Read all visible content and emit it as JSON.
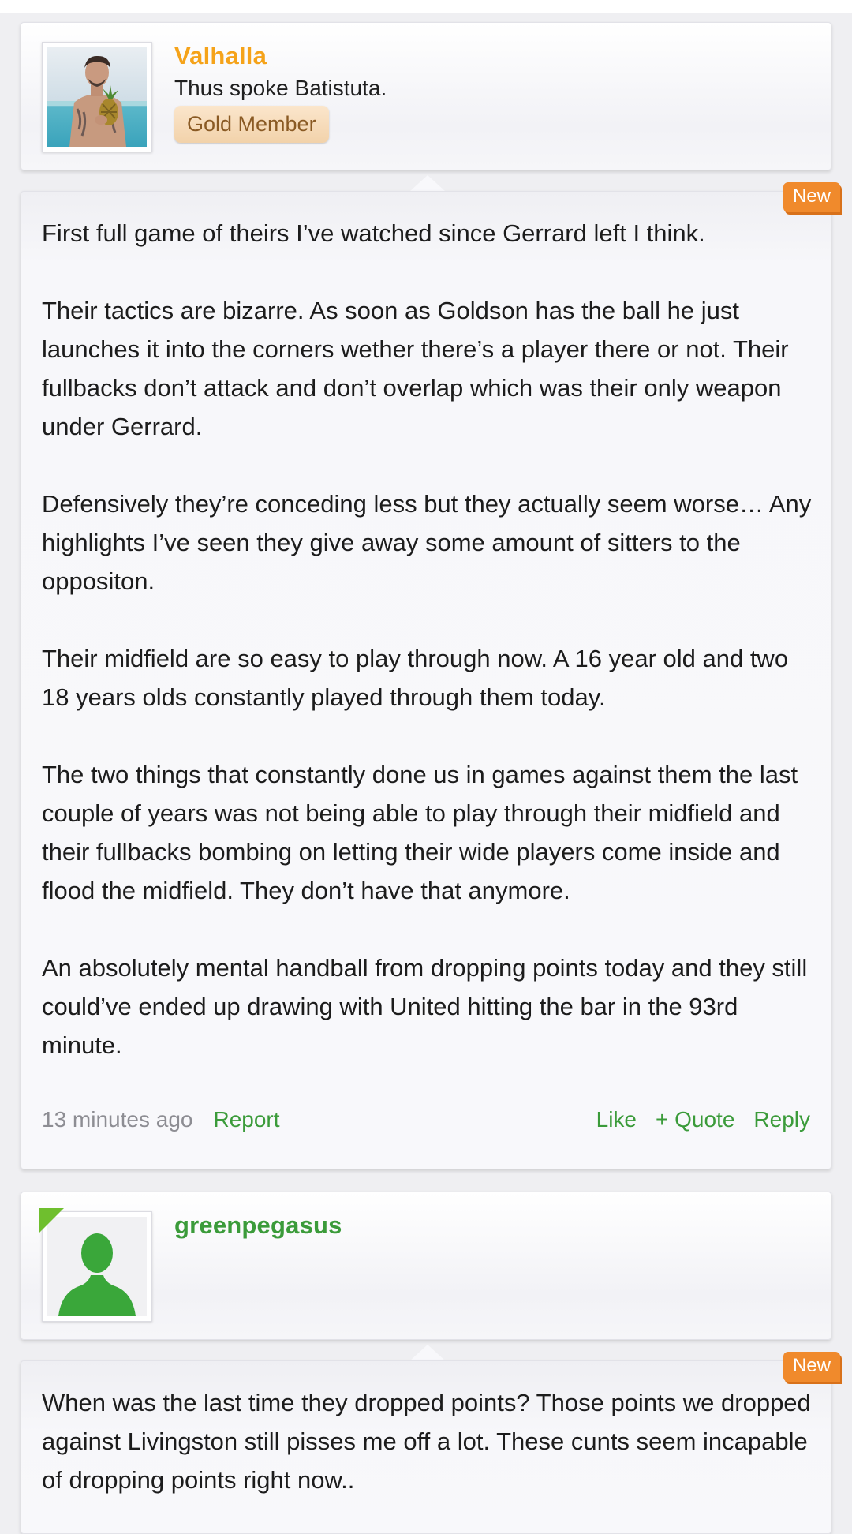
{
  "posts": [
    {
      "username": "Valhalla",
      "username_color": "#f5a31a",
      "user_title": "Thus spoke Batistuta.",
      "rank": "Gold Member",
      "avatar_icon": "user-photo",
      "new_label": "New",
      "paragraphs": [
        "First full game of theirs I’ve watched since Gerrard left I think.",
        "Their tactics are bizarre. As soon as Goldson has the ball he just launches it into the corners wether there’s a player there or not. Their fullbacks don’t attack and don’t overlap which was their only weapon under Gerrard.",
        "Defensively they’re conceding less but they actually seem worse… Any highlights I’ve seen they give away some amount of sitters to the oppositon.",
        "Their midfield are so easy to play through now. A 16 year old and two 18 years olds constantly played through them today.",
        "The two things that constantly done us in games against them the last couple of years was not being able to play through their midfield and their fullbacks bombing on letting their wide players come inside and flood the midfield. They don’t have that anymore.",
        "An absolutely mental handball from dropping points today and they still could’ve ended up drawing with United hitting the bar in the 93rd minute."
      ],
      "timestamp": "13 minutes ago",
      "report_label": "Report",
      "like_label": "Like",
      "quote_label": "+ Quote",
      "reply_label": "Reply"
    },
    {
      "username": "greenpegasus",
      "username_color": "#3b9b3a",
      "avatar_icon": "default-user-silhouette",
      "new_label": "New",
      "paragraphs": [
        "When was the last time they dropped points? Those points we dropped against Livingston still pisses me off a lot. These cunts seem incapable of dropping points right now.."
      ]
    }
  ],
  "colors": {
    "accent_green": "#3b9b3a",
    "badge_orange": "#f08a2c",
    "gold_username": "#f5a31a"
  }
}
